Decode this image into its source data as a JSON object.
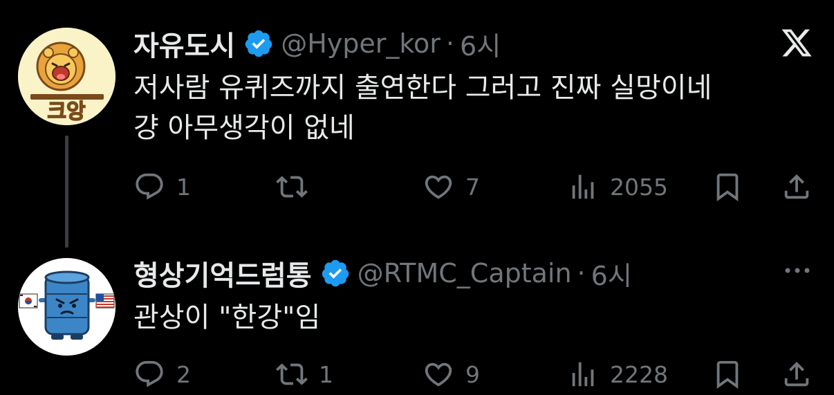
{
  "tweets": [
    {
      "display_name": "자유도시",
      "handle": "@Hyper_kor",
      "separator": "·",
      "time": "6시",
      "text_line1": "저사람 유퀴즈까지 출연한다 그러고 진짜 실망이네",
      "text_line2": "걍 아무생각이 없네",
      "avatar_text": "크앙",
      "replies": "1",
      "retweets": "",
      "likes": "7",
      "views": "2055",
      "verified": true
    },
    {
      "display_name": "형상기억드럼통",
      "handle": "@RTMC_Captain",
      "separator": "·",
      "time": "6시",
      "text_line1": "관상이 \"한강\"임",
      "replies": "2",
      "retweets": "1",
      "likes": "9",
      "views": "2228",
      "verified": true
    }
  ],
  "colors": {
    "background": "#000000",
    "text": "#e7e9ea",
    "secondary": "#71767b",
    "verified": "#1d9bf0"
  },
  "icons": [
    "x-logo-icon",
    "verified-badge-icon",
    "reply-icon",
    "retweet-icon",
    "like-icon",
    "views-icon",
    "bookmark-icon",
    "share-icon",
    "more-icon"
  ]
}
